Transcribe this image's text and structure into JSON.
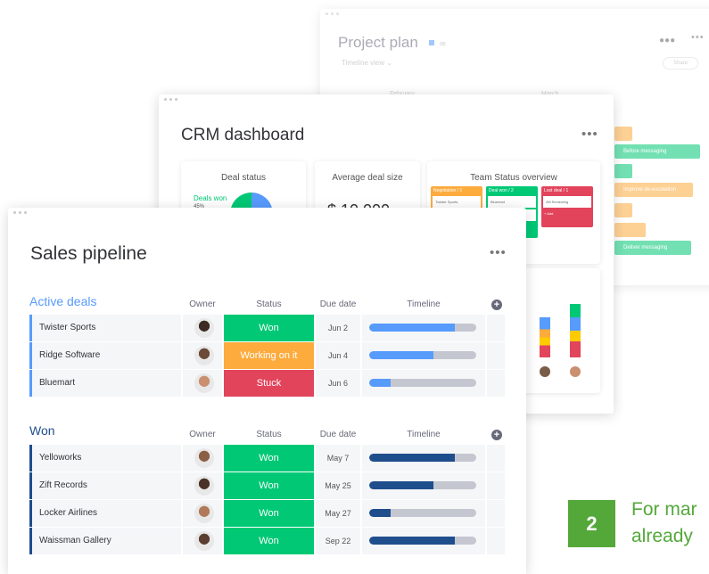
{
  "project_plan": {
    "title": "Project plan",
    "view_label": "Timeline view",
    "share_label": "Share",
    "columns": [
      "February",
      "March"
    ],
    "bars": [
      "Before messaging",
      "Improve de-escalation",
      "Deliver messaging"
    ]
  },
  "crm": {
    "title": "CRM dashboard",
    "deal_status": {
      "title": "Deal status",
      "legend": "Deals won",
      "legend_value": "45%"
    },
    "avg_deal": {
      "title": "Average deal size",
      "value": "$ 10,000"
    },
    "team_status": {
      "title": "Team Status overview",
      "columns": [
        {
          "header": "Negotiation / 1",
          "color": "#fdab3d",
          "items": [
            "Twister Sports"
          ]
        },
        {
          "header": "Deal won / 2",
          "color": "#00c875",
          "items": [
            "Bluemart",
            "Zift Records"
          ]
        },
        {
          "header": "Lost deal / 1",
          "color": "#e2445c",
          "items": [
            "Zift Reviewing"
          ]
        }
      ],
      "add_label": "+ Add"
    },
    "stacked_bars": {
      "colors": [
        "#00c875",
        "#579bfc",
        "#fdab3d",
        "#e2445c",
        "#ffcb00"
      ]
    }
  },
  "sales": {
    "title": "Sales pipeline",
    "columns": [
      "Owner",
      "Status",
      "Due date",
      "Timeline"
    ],
    "groups": [
      {
        "title": "Active deals",
        "color": "#579bfc",
        "rows": [
          {
            "name": "Twister Sports",
            "status": "Won",
            "status_color": "#00c875",
            "due": "Jun 2",
            "progress": 0.8
          },
          {
            "name": "Ridge Software",
            "status": "Working on it",
            "status_color": "#fdab3d",
            "due": "Jun 4",
            "progress": 0.6
          },
          {
            "name": "Bluemart",
            "status": "Stuck",
            "status_color": "#e2445c",
            "due": "Jun 6",
            "progress": 0.2
          }
        ]
      },
      {
        "title": "Won",
        "color": "#1f4e8c",
        "rows": [
          {
            "name": "Yelloworks",
            "status": "Won",
            "status_color": "#00c875",
            "due": "May 7",
            "progress": 0.8
          },
          {
            "name": "Zift Records",
            "status": "Won",
            "status_color": "#00c875",
            "due": "May 25",
            "progress": 0.6
          },
          {
            "name": "Locker Airlines",
            "status": "Won",
            "status_color": "#00c875",
            "due": "May 27",
            "progress": 0.2
          },
          {
            "name": "Waissman Gallery",
            "status": "Won",
            "status_color": "#00c875",
            "due": "Sep 22",
            "progress": 0.8
          }
        ]
      }
    ]
  },
  "step": {
    "number": "2",
    "caption_line1": "For mar",
    "caption_line2": "already"
  }
}
